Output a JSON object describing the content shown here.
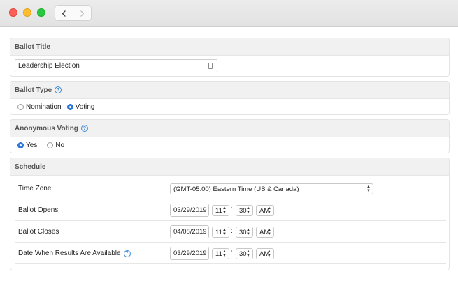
{
  "window": {
    "nav": {
      "back_glyph": "‹",
      "forward_glyph": "›"
    }
  },
  "ballot_title": {
    "header": "Ballot Title",
    "value": "Leadership Election"
  },
  "ballot_type": {
    "header": "Ballot Type",
    "help": "?",
    "options": [
      {
        "label": "Nomination",
        "selected": false
      },
      {
        "label": "Voting",
        "selected": true
      }
    ]
  },
  "anonymous_voting": {
    "header": "Anonymous Voting",
    "help": "?",
    "options": [
      {
        "label": "Yes",
        "selected": true
      },
      {
        "label": "No",
        "selected": false
      }
    ]
  },
  "schedule": {
    "header": "Schedule",
    "time_zone": {
      "label": "Time Zone",
      "value": "(GMT-05:00) Eastern Time (US & Canada)"
    },
    "ballot_opens": {
      "label": "Ballot Opens",
      "date": "03/29/2019",
      "hour": "11",
      "minute": "30",
      "ampm": "AM"
    },
    "ballot_closes": {
      "label": "Ballot Closes",
      "date": "04/08/2019",
      "hour": "11",
      "minute": "30",
      "ampm": "AM"
    },
    "results_available": {
      "label": "Date When Results Are Available",
      "help": "?",
      "date": "03/29/2019",
      "hour": "11",
      "minute": "30",
      "ampm": "AM"
    },
    "colon": ":"
  },
  "colors": {
    "accent": "#2f7de1",
    "help": "#3d8bd9",
    "close": "#fe5f57",
    "minimize": "#febc2e",
    "zoom": "#28c840"
  }
}
